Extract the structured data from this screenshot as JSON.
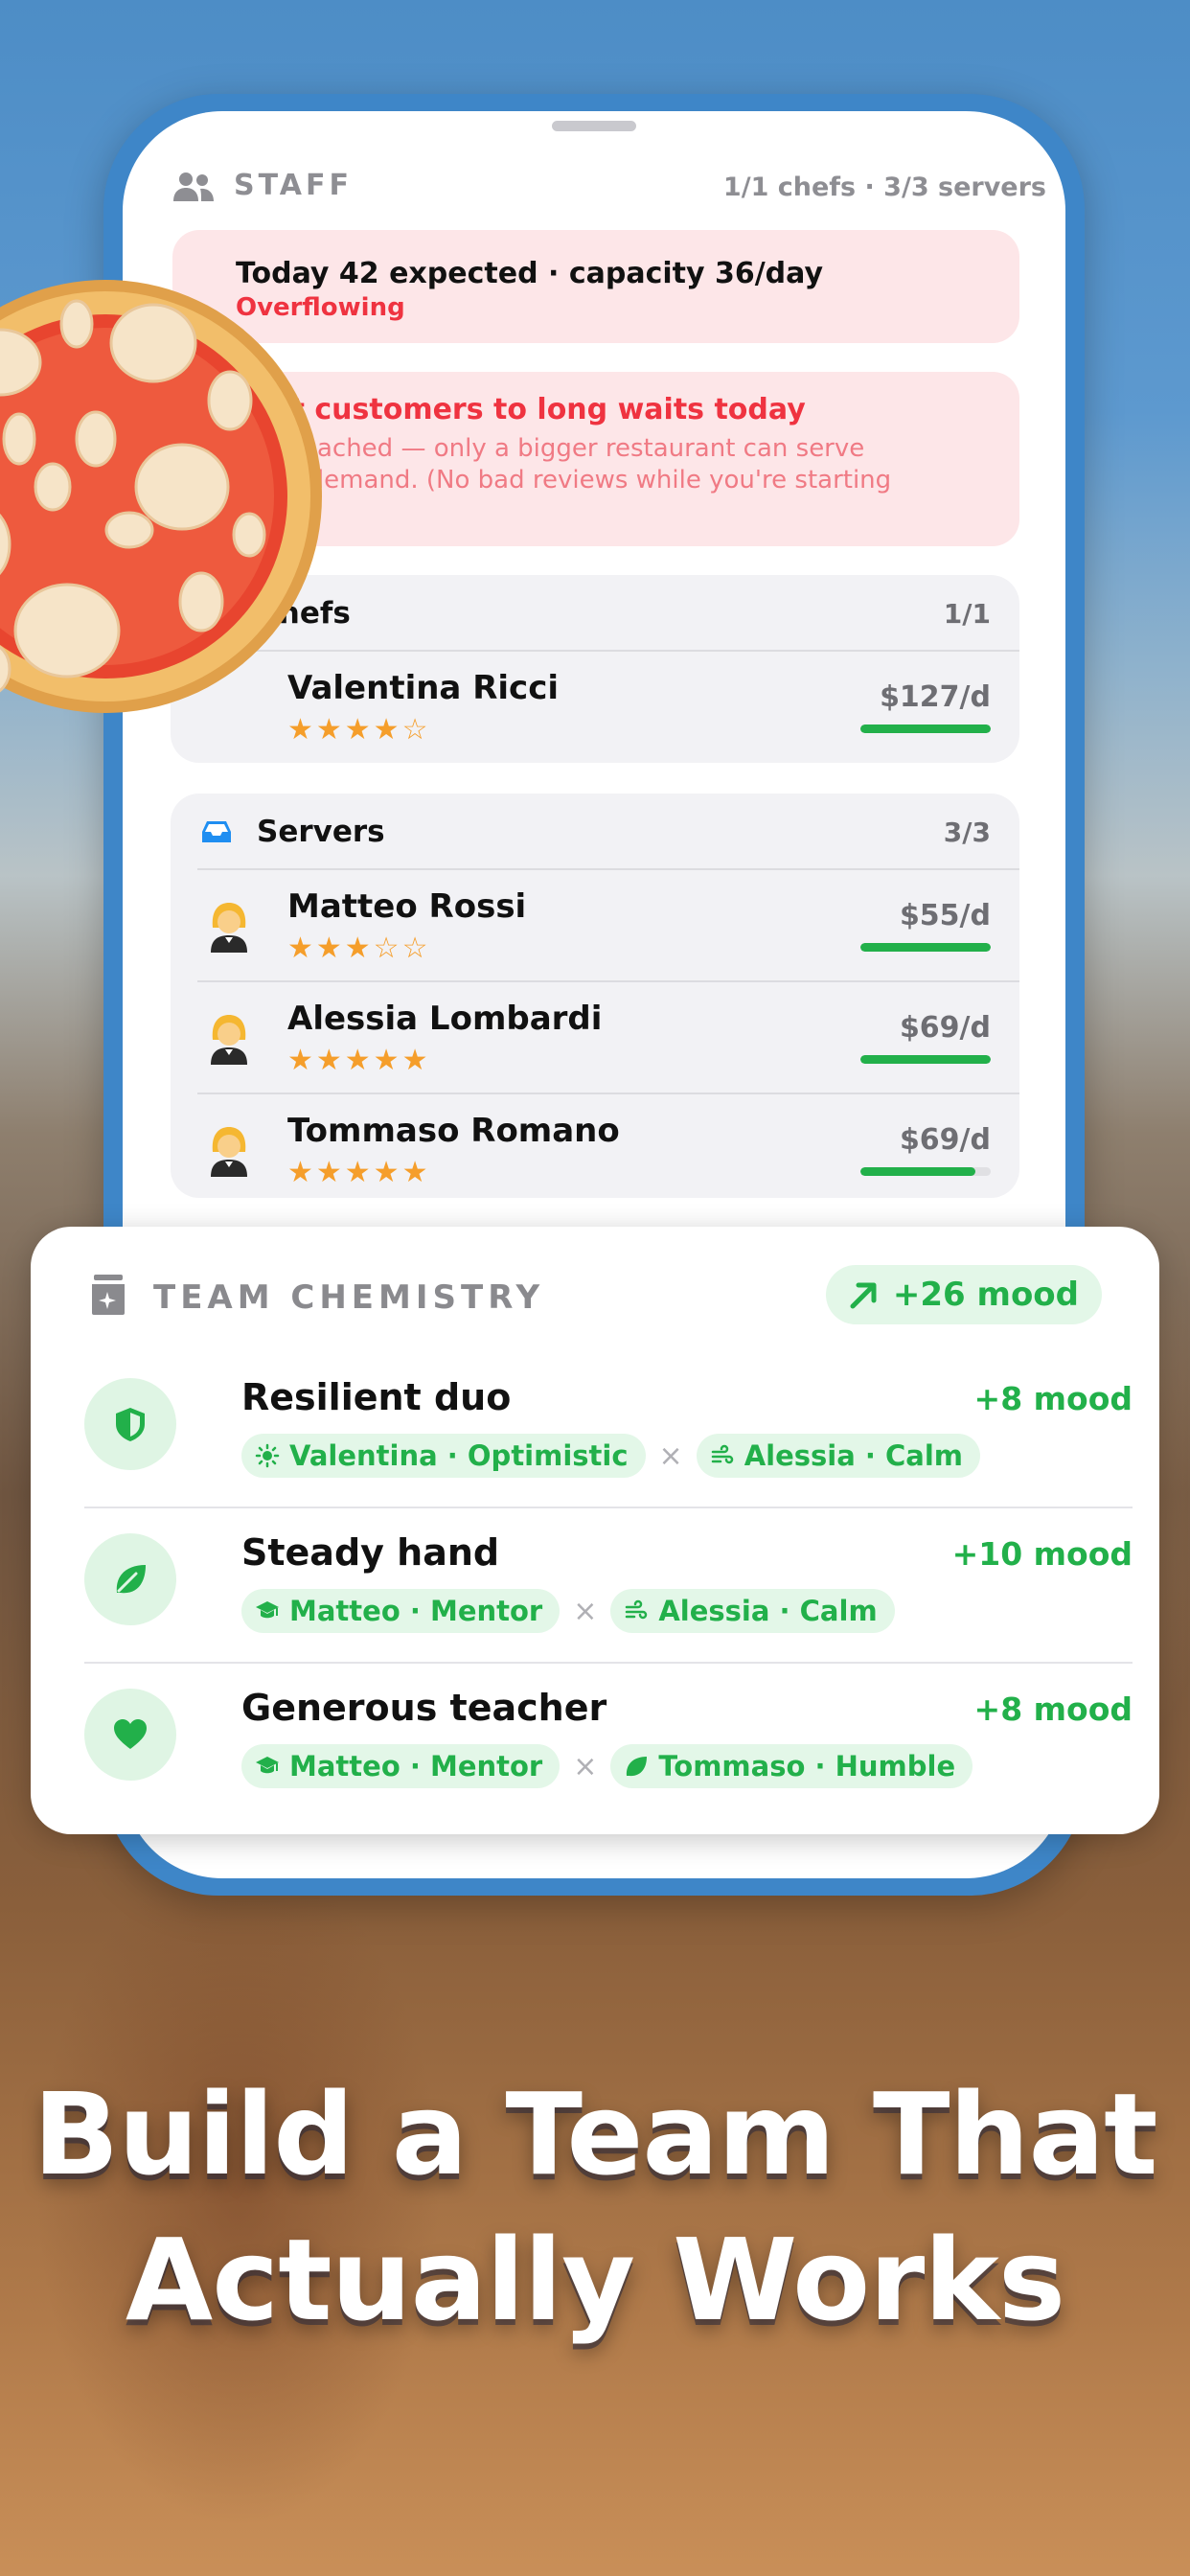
{
  "staff": {
    "title": "STAFF",
    "count": "1/1 chefs · 3/3 servers",
    "alert_capacity": {
      "line1": "Today 42 expected · capacity 36/day",
      "line2": "Overflowing"
    },
    "alert_waits": {
      "title": "Lost customers to long waits today",
      "body": "Cap reached — only a bigger restaurant can serve more demand. (No bad reviews while you're starting out.)"
    },
    "chefs": {
      "title": "Chefs",
      "count": "1/1",
      "rows": [
        {
          "name": "Valentina Ricci",
          "rating": 4,
          "stars": "★★★★☆",
          "wage": "$127/d",
          "bar_fraction": 1.0
        }
      ]
    },
    "servers": {
      "title": "Servers",
      "count": "3/3",
      "rows": [
        {
          "name": "Matteo Rossi",
          "rating": 3,
          "stars": "★★★☆☆",
          "wage": "$55/d",
          "bar_fraction": 1.0
        },
        {
          "name": "Alessia Lombardi",
          "rating": 5,
          "stars": "★★★★★",
          "wage": "$69/d",
          "bar_fraction": 1.0
        },
        {
          "name": "Tommaso Romano",
          "rating": 5,
          "stars": "★★★★★",
          "wage": "$69/d",
          "bar_fraction": 0.88
        }
      ]
    }
  },
  "chemistry": {
    "title": "TEAM CHEMISTRY",
    "total": "+26 mood",
    "combos": [
      {
        "title": "Resilient duo",
        "mood": "+8 mood",
        "icon": "shield-icon",
        "chips": [
          {
            "label": "Valentina · Optimistic",
            "icon": "sun-icon"
          },
          {
            "label": "Alessia · Calm",
            "icon": "wind-icon"
          }
        ]
      },
      {
        "title": "Steady hand",
        "mood": "+10 mood",
        "icon": "leaf-icon",
        "chips": [
          {
            "label": "Matteo · Mentor",
            "icon": "graduation-cap-icon"
          },
          {
            "label": "Alessia · Calm",
            "icon": "wind-icon"
          }
        ]
      },
      {
        "title": "Generous teacher",
        "mood": "+8 mood",
        "icon": "heart-icon",
        "chips": [
          {
            "label": "Matteo · Mentor",
            "icon": "graduation-cap-icon"
          },
          {
            "label": "Tommaso · Humble",
            "icon": "leaf-icon"
          }
        ]
      }
    ],
    "separator": "×"
  },
  "headline": {
    "line1": "Build a Team That",
    "line2": "Actually Works"
  },
  "colors": {
    "accent_green": "#22b04a",
    "alert_red": "#ef3340",
    "star_orange": "#f59e2b",
    "phone_frame_blue": "#3e86c8"
  }
}
